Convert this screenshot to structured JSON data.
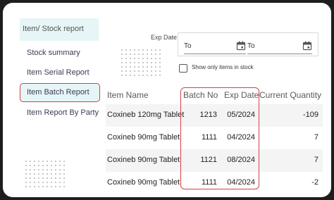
{
  "sidebar": {
    "header": "Item/ Stock report",
    "items": [
      {
        "label": "Stock summary"
      },
      {
        "label": "Item Serial Report"
      },
      {
        "label": "Item Batch Report",
        "selected": true
      },
      {
        "label": "Item Report By Party"
      }
    ]
  },
  "filters": {
    "exp_date_label": "Exp Date",
    "from_label": "To",
    "to_label": "To",
    "from_value": "",
    "to_value": "",
    "show_only_in_stock_label": "Show only items in stock",
    "show_only_in_stock_checked": false
  },
  "table": {
    "columns": [
      "Item Name",
      "Batch No",
      "Exp Date",
      "Current Quantity"
    ],
    "rows": [
      {
        "item_name": "Coxineb 120mg Tablet",
        "batch_no": "1213",
        "exp_date": "05/2024",
        "current_quantity": "-109"
      },
      {
        "item_name": "Coxineb 90mg Tablet",
        "batch_no": "1111",
        "exp_date": "04/2024",
        "current_quantity": "7"
      },
      {
        "item_name": "Coxineb 90mg Tablet",
        "batch_no": "1121",
        "exp_date": "08/2024",
        "current_quantity": "7"
      },
      {
        "item_name": "Coxineb 90mg Tablet",
        "batch_no": "1111",
        "exp_date": "04/2024",
        "current_quantity": "-2"
      }
    ]
  },
  "colors": {
    "highlight": "#d1404a",
    "selected_bg": "#e6f5f6"
  },
  "icons": {
    "date_picker": "calendar-icon",
    "checkbox": "checkbox-unchecked"
  }
}
